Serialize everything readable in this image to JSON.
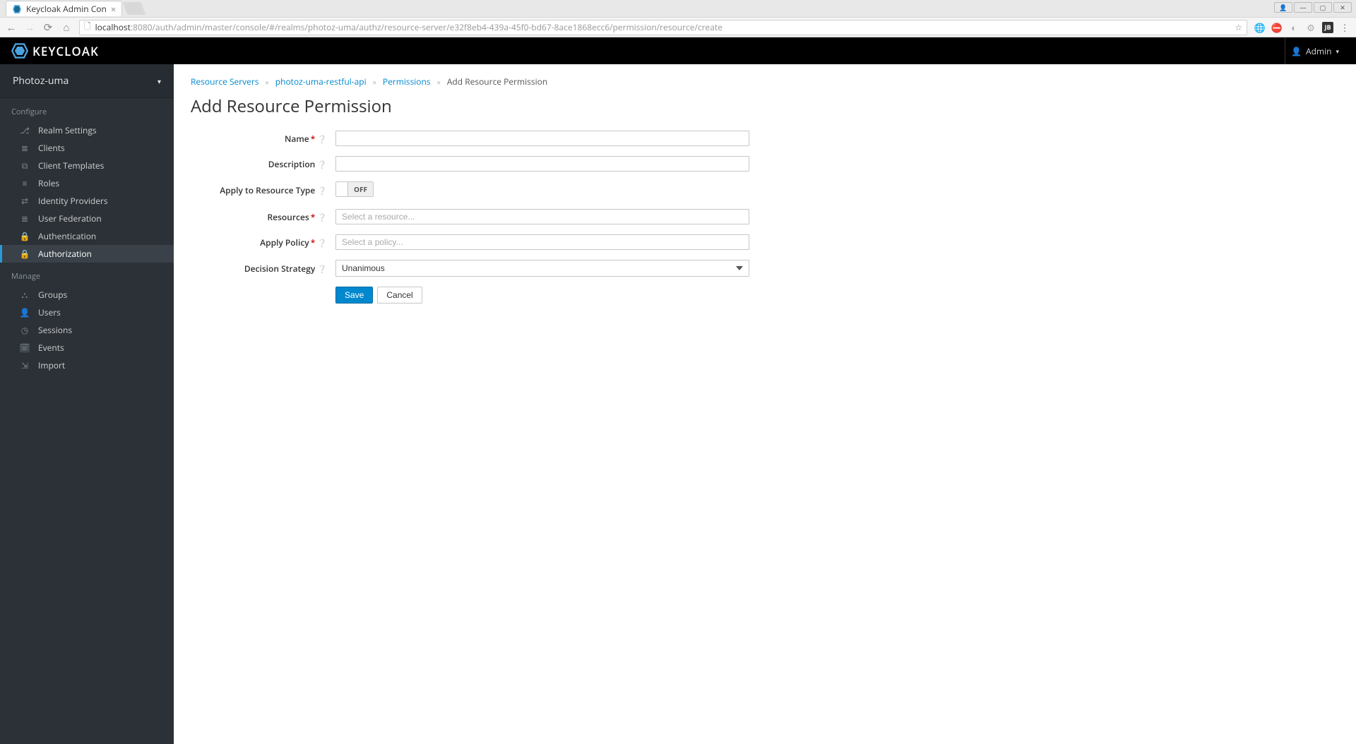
{
  "browser": {
    "tab_title": "Keycloak Admin Con",
    "url_host": "localhost",
    "url_path": ":8080/auth/admin/master/console/#/realms/photoz-uma/authz/resource-server/e32f8eb4-439a-45f0-bd67-8ace1868ecc6/permission/resource/create"
  },
  "header": {
    "brand": "KEYCLOAK",
    "user": "Admin"
  },
  "sidebar": {
    "realm": "Photoz-uma",
    "section_configure": "Configure",
    "section_manage": "Manage",
    "configure": [
      {
        "label": "Realm Settings",
        "icon": "sliders"
      },
      {
        "label": "Clients",
        "icon": "layers"
      },
      {
        "label": "Client Templates",
        "icon": "templates"
      },
      {
        "label": "Roles",
        "icon": "list"
      },
      {
        "label": "Identity Providers",
        "icon": "exchange"
      },
      {
        "label": "User Federation",
        "icon": "database"
      },
      {
        "label": "Authentication",
        "icon": "lock"
      },
      {
        "label": "Authorization",
        "icon": "lock"
      }
    ],
    "manage": [
      {
        "label": "Groups",
        "icon": "group"
      },
      {
        "label": "Users",
        "icon": "user"
      },
      {
        "label": "Sessions",
        "icon": "clock"
      },
      {
        "label": "Events",
        "icon": "calendar"
      },
      {
        "label": "Import",
        "icon": "import"
      }
    ]
  },
  "breadcrumb": {
    "level0": "Resource Servers",
    "level1": "photoz-uma-restful-api",
    "level2": "Permissions",
    "current": "Add Resource Permission"
  },
  "page": {
    "title": "Add Resource Permission"
  },
  "form": {
    "name_label": "Name",
    "description_label": "Description",
    "apply_resource_type_label": "Apply to Resource Type",
    "apply_resource_type_value": "OFF",
    "resources_label": "Resources",
    "resources_placeholder": "Select a resource...",
    "apply_policy_label": "Apply Policy",
    "apply_policy_placeholder": "Select a policy...",
    "decision_strategy_label": "Decision Strategy",
    "decision_strategy_value": "Unanimous",
    "save": "Save",
    "cancel": "Cancel"
  }
}
